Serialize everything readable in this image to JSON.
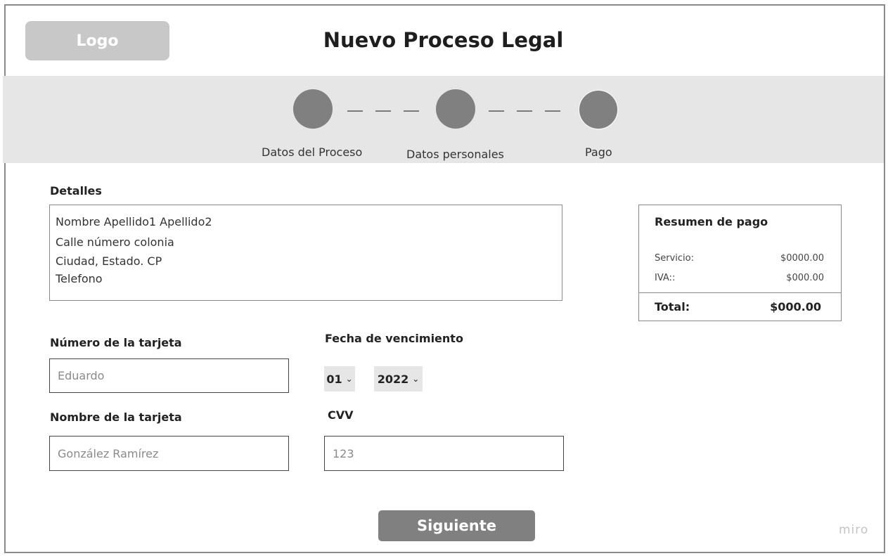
{
  "header": {
    "logo": "Logo",
    "title": "Nuevo Proceso Legal"
  },
  "stepper": {
    "steps": [
      {
        "label": "Datos del Proceso"
      },
      {
        "label": "Datos personales"
      },
      {
        "label": "Pago"
      }
    ],
    "connector": "— — —"
  },
  "details": {
    "label": "Detalles",
    "lines": [
      "Nombre Apellido1 Apellido2",
      "Calle número colonia",
      "Ciudad, Estado. CP",
      "Telefono"
    ]
  },
  "card_form": {
    "card_number_label": "Número de la tarjeta",
    "card_number_value": "Eduardo",
    "card_name_label": "Nombre de la tarjeta",
    "card_name_value": "González Ramírez",
    "expiry_label": "Fecha de vencimiento",
    "expiry_month": "01",
    "expiry_year": "2022",
    "cvv_label": "CVV",
    "cvv_value": "123"
  },
  "summary": {
    "title": "Resumen de pago",
    "service_label": "Servicio:",
    "service_value": "$0000.00",
    "iva_label": "IVA::",
    "iva_value": "$000.00",
    "total_label": "Total:",
    "total_value": "$000.00"
  },
  "actions": {
    "next_label": "Siguiente"
  },
  "watermark": "miro",
  "colors": {
    "accent_gray": "#808080",
    "band_gray": "#e6e6e6",
    "logo_gray": "#c8c8c8"
  }
}
